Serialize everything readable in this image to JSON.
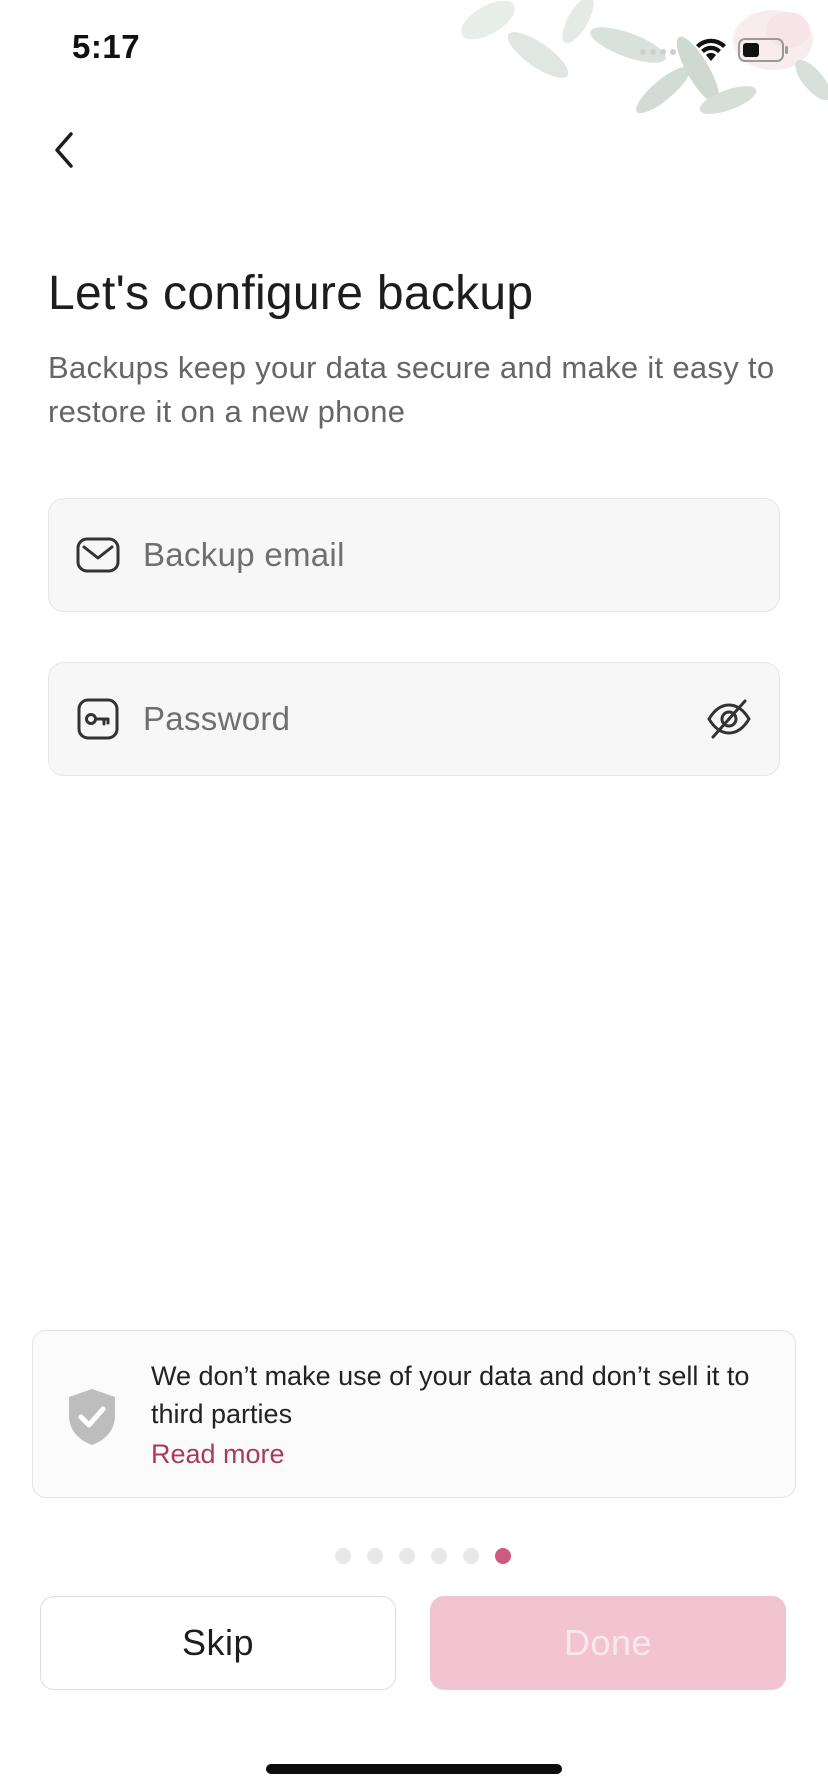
{
  "status_bar": {
    "time": "5:17",
    "icons": [
      "signal-icon",
      "wifi-icon",
      "battery-icon"
    ]
  },
  "header": {
    "back_icon": "chevron-left-icon"
  },
  "main": {
    "title": "Let's configure backup",
    "subtitle": "Backups keep your data secure and make it easy to restore it on a new phone",
    "email_field": {
      "icon": "envelope-icon",
      "placeholder": "Backup email",
      "value": ""
    },
    "password_field": {
      "icon": "key-icon",
      "placeholder": "Password",
      "value": "",
      "visibility_icon": "eye-off-icon"
    }
  },
  "privacy_notice": {
    "icon": "shield-check-icon",
    "text": "We don’t make use of your data and don’t sell it to third parties",
    "link": "Read more"
  },
  "pagination": {
    "total": 6,
    "current": 6
  },
  "actions": {
    "skip_label": "Skip",
    "done_label": "Done",
    "done_enabled": false
  },
  "colors": {
    "accent": "#d0597f",
    "link": "#a93a5e",
    "done_disabled_bg": "#f2c3d0"
  }
}
